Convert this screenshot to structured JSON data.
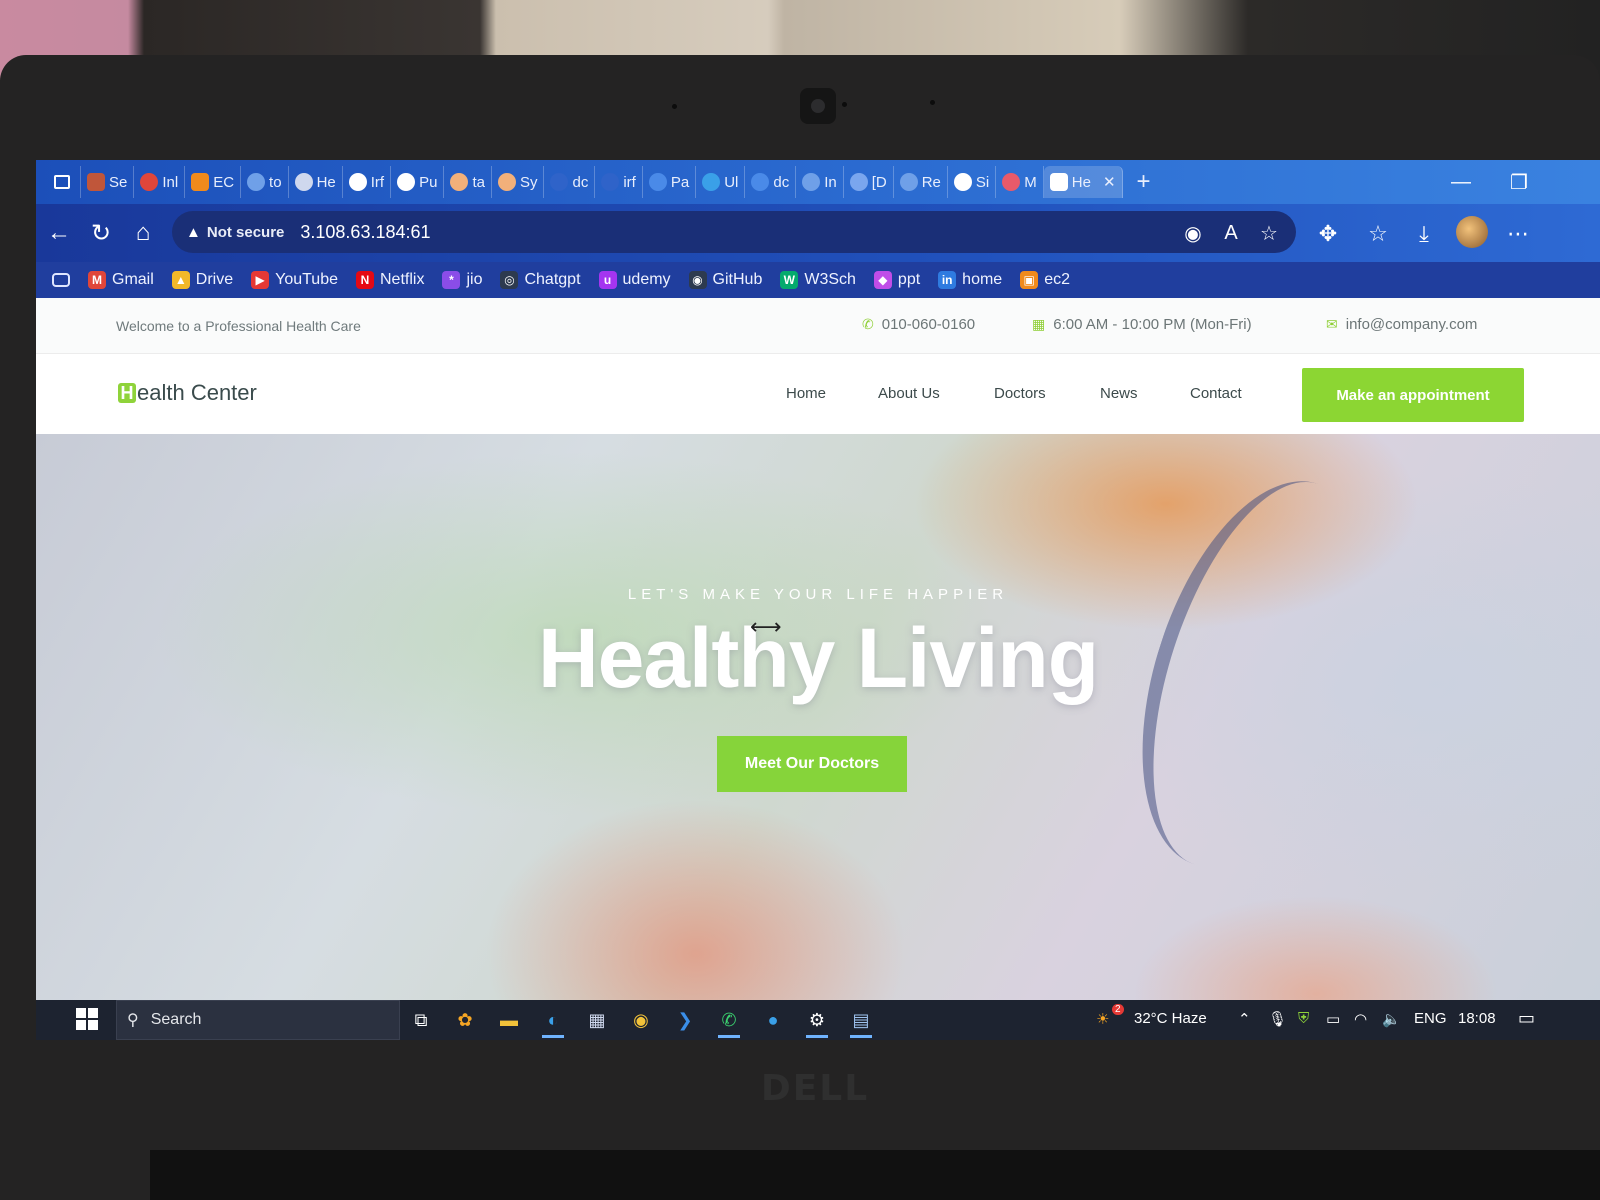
{
  "browser": {
    "tabs": [
      {
        "label": "Se",
        "icon": "red-square",
        "color": "#c0563a"
      },
      {
        "label": "Inl",
        "icon": "gmail-icon",
        "color": "#e0463a"
      },
      {
        "label": "EC",
        "icon": "orange-cube",
        "color": "#f08a1c"
      },
      {
        "label": "to",
        "icon": "search-icon",
        "color": "#6fa0e8"
      },
      {
        "label": "He",
        "icon": "globe-icon",
        "color": "#cfd8ee"
      },
      {
        "label": "Irf",
        "icon": "github-icon",
        "color": "#ffffff"
      },
      {
        "label": "Pu",
        "icon": "chatgpt-icon",
        "color": "#ffffff"
      },
      {
        "label": "ta",
        "icon": "avatar-icon",
        "color": "#f2b07a"
      },
      {
        "label": "Sy",
        "icon": "avatar-icon",
        "color": "#f2b07a"
      },
      {
        "label": "dc",
        "icon": "circle-icon",
        "color": "#2f63c9"
      },
      {
        "label": "irf",
        "icon": "circle-icon",
        "color": "#2f63c9"
      },
      {
        "label": "Pa",
        "icon": "circle-icon",
        "color": "#4a8ae8"
      },
      {
        "label": "Ul",
        "icon": "edge-icon",
        "color": "#3aa0e8"
      },
      {
        "label": "dc",
        "icon": "circle-icon",
        "color": "#4a8ae8"
      },
      {
        "label": "In",
        "icon": "circle-icon",
        "color": "#6fa0e8"
      },
      {
        "label": "[D",
        "icon": "gmail-icon",
        "color": "#7aa6ee"
      },
      {
        "label": "Re",
        "icon": "circle-icon",
        "color": "#6fa0e8"
      },
      {
        "label": "Si",
        "icon": "google-icon",
        "color": "#ffffff"
      },
      {
        "label": "M",
        "icon": "record-icon",
        "color": "#e85a6a"
      },
      {
        "label": "He",
        "icon": "active-tab",
        "color": "#ffffff",
        "active": true
      }
    ],
    "new_tab_label": "+",
    "address": {
      "security_label": "Not secure",
      "url": "3.108.63.184:61"
    },
    "bookmarks": [
      {
        "label": "Gmail",
        "icon": "gmail-icon",
        "color": "#e0463a",
        "glyph": "M"
      },
      {
        "label": "Drive",
        "icon": "drive-icon",
        "color": "#f1b829",
        "glyph": "▲"
      },
      {
        "label": "YouTube",
        "icon": "youtube-icon",
        "color": "#e53935",
        "glyph": "▶"
      },
      {
        "label": "Netflix",
        "icon": "netflix-icon",
        "color": "#e50914",
        "glyph": "N"
      },
      {
        "label": "jio",
        "icon": "jio-icon",
        "color": "#8a4de8",
        "glyph": "*"
      },
      {
        "label": "Chatgpt",
        "icon": "chatgpt-icon",
        "color": "#2d3a4f",
        "glyph": "◎"
      },
      {
        "label": "udemy",
        "icon": "udemy-icon",
        "color": "#a435f0",
        "glyph": "u"
      },
      {
        "label": "GitHub",
        "icon": "github-icon",
        "color": "#2d3a4f",
        "glyph": "◉"
      },
      {
        "label": "W3Sch",
        "icon": "w3schools-icon",
        "color": "#04aa6d",
        "glyph": "W"
      },
      {
        "label": "ppt",
        "icon": "ppt-icon",
        "color": "#c04de8",
        "glyph": "◆"
      },
      {
        "label": "home",
        "icon": "linkedin-icon",
        "color": "#2f7be0",
        "glyph": "in"
      },
      {
        "label": "ec2",
        "icon": "aws-icon",
        "color": "#f08a1c",
        "glyph": "▣"
      }
    ]
  },
  "site": {
    "topbar": {
      "welcome": "Welcome to a Professional Health Care",
      "phone": "010-060-0160",
      "hours": "6:00 AM - 10:00 PM (Mon-Fri)",
      "email": "info@company.com"
    },
    "logo": {
      "mark": "H",
      "text": "ealth Center"
    },
    "nav": [
      "Home",
      "About Us",
      "Doctors",
      "News",
      "Contact"
    ],
    "cta": "Make an appointment",
    "hero": {
      "subtitle": "LET'S MAKE YOUR LIFE HAPPIER",
      "title": "Healthy Living",
      "button": "Meet Our Doctors"
    },
    "accent_color": "#8cd633"
  },
  "taskbar": {
    "search_placeholder": "Search",
    "weather": "32°C  Haze",
    "weather_badge": "2",
    "language": "ENG",
    "time": "18:08"
  },
  "device_brand": "DELL"
}
